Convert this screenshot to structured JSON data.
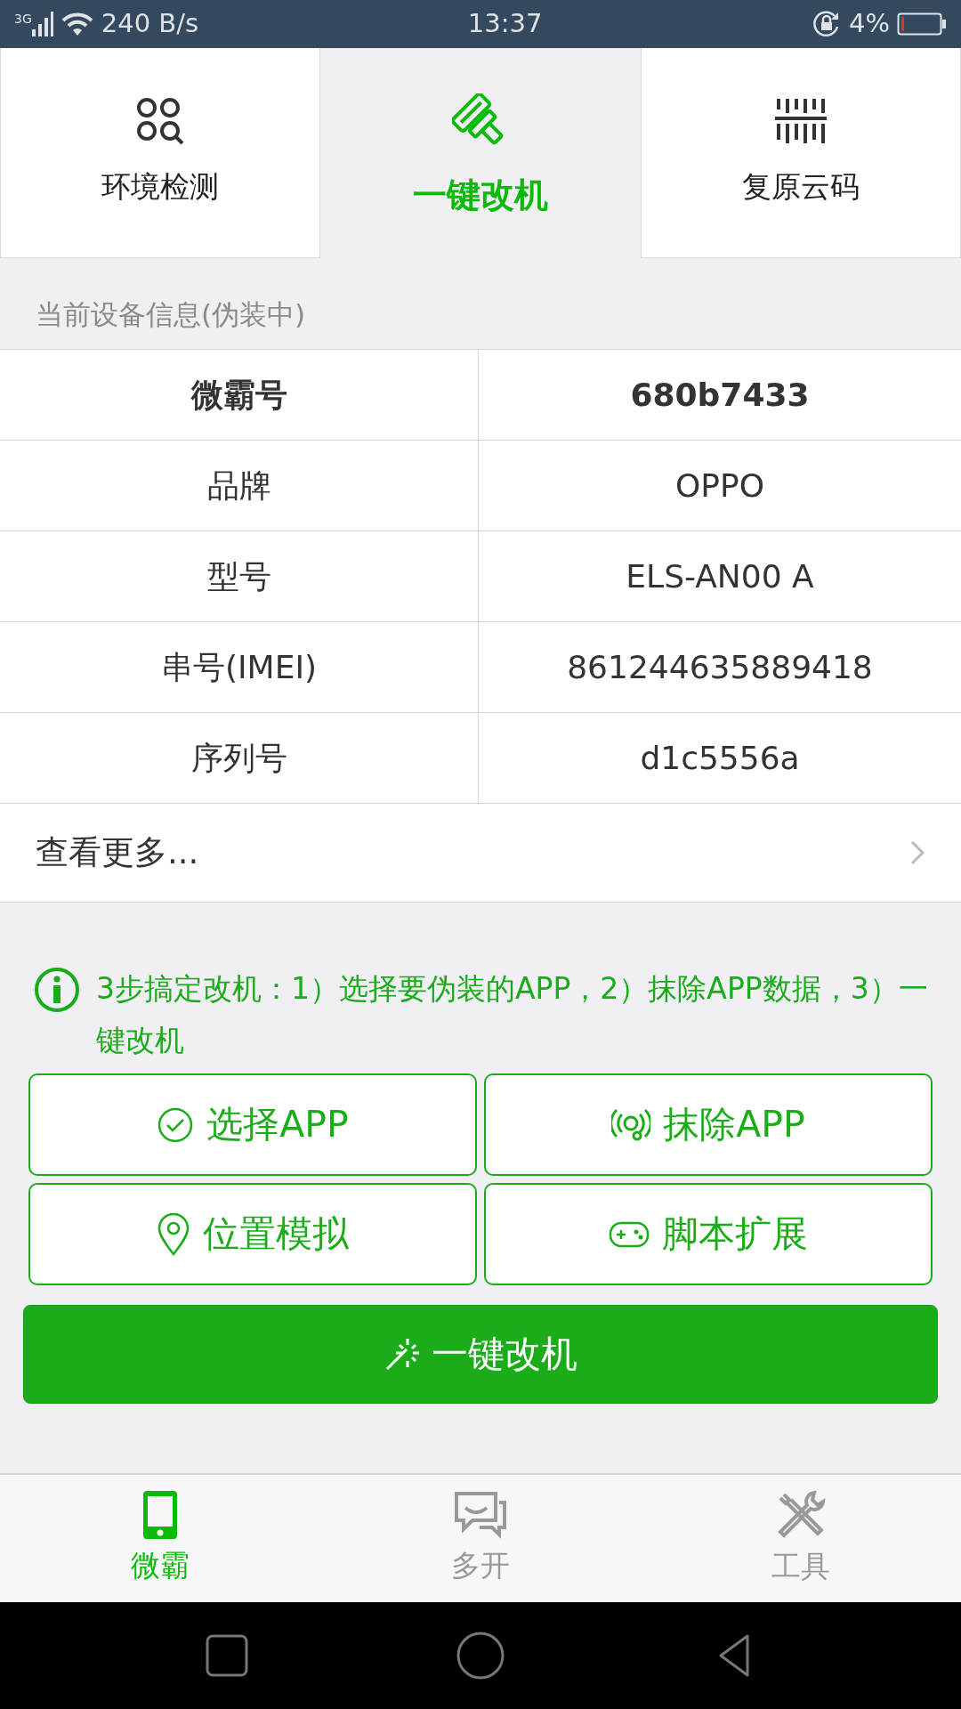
{
  "status_bar": {
    "network": "3G",
    "speed": "240 B/s",
    "time": "13:37",
    "battery": "4%"
  },
  "tabs": [
    {
      "label": "环境检测",
      "selected": false
    },
    {
      "label": "一键改机",
      "selected": true
    },
    {
      "label": "复原云码",
      "selected": false
    }
  ],
  "section_title": "当前设备信息(伪装中)",
  "device_info": [
    {
      "label": "微霸号",
      "value": "680b7433",
      "emphasized": true
    },
    {
      "label": "品牌",
      "value": "OPPO",
      "emphasized": false
    },
    {
      "label": "型号",
      "value": "ELS-AN00 A",
      "emphasized": false
    },
    {
      "label": "串号(IMEI)",
      "value": "861244635889418",
      "emphasized": false
    },
    {
      "label": "序列号",
      "value": "d1c5556a",
      "emphasized": false
    }
  ],
  "more_link": "查看更多...",
  "tip": "3步搞定改机：1）选择要伪装的APP，2）抹除APP数据，3）一键改机",
  "actions": [
    {
      "label": "选择APP"
    },
    {
      "label": "抹除APP"
    },
    {
      "label": "位置模拟"
    },
    {
      "label": "脚本扩展"
    }
  ],
  "primary_button": "一键改机",
  "bottom_nav": [
    {
      "label": "微霸",
      "selected": true
    },
    {
      "label": "多开",
      "selected": false
    },
    {
      "label": "工具",
      "selected": false
    }
  ]
}
